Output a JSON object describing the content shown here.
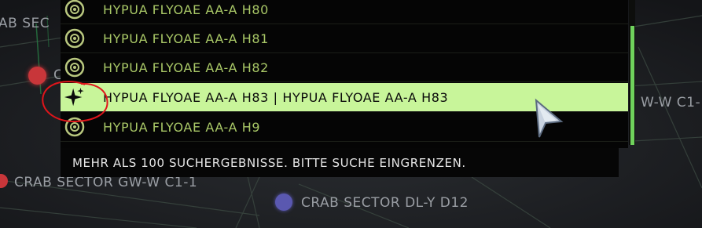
{
  "map": {
    "labels": [
      {
        "id": "ab-sec",
        "text": "AB SEC"
      },
      {
        "id": "gw-w-right",
        "text": "W-W C1-"
      },
      {
        "id": "crab-gw-w",
        "text": "CRAB SECTOR GW-W C1-1"
      },
      {
        "id": "crab-dl-y",
        "text": "CRAB SECTOR DL-Y D12"
      },
      {
        "id": "partial-c",
        "text": "C"
      }
    ],
    "colors": {
      "red_system": "#c8363a",
      "purple_system": "#5a58b0",
      "grid_line": "#3a4a42"
    }
  },
  "results": {
    "rows": [
      {
        "icon": "planet-orbit-icon",
        "label": "HYPUA FLYOAE AA-A H80",
        "selected": false
      },
      {
        "icon": "planet-orbit-icon",
        "label": "HYPUA FLYOAE AA-A H81",
        "selected": false
      },
      {
        "icon": "planet-orbit-icon",
        "label": "HYPUA FLYOAE AA-A H82",
        "selected": false
      },
      {
        "icon": "sparkle-star-icon",
        "label": "HYPUA FLYOAE AA-A H83  | HYPUA FLYOAE AA-A H83",
        "selected": true
      },
      {
        "icon": "planet-orbit-icon",
        "label": "HYPUA FLYOAE AA-A H9",
        "selected": false
      }
    ],
    "colors": {
      "row_text": "#a9c867",
      "selected_background": "#c8f59a",
      "scrollbar": "#6fd25c"
    }
  },
  "status": {
    "message": "MEHR ALS 100 SUCHERGEBNISSE. BITTE SUCHE EINGRENZEN."
  },
  "annotation": {
    "color": "#e0151b",
    "shape": "hand-drawn circle around selected row icon"
  }
}
